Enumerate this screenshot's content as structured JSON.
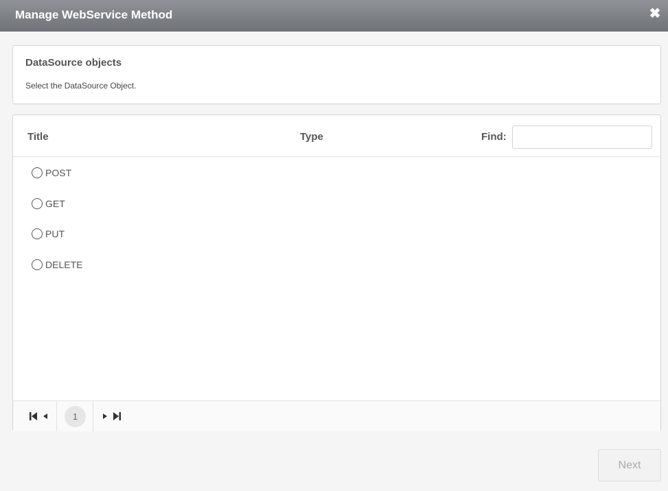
{
  "dialog": {
    "title": "Manage WebService Method",
    "close_icon": "close-icon"
  },
  "info_panel": {
    "heading": "DataSource objects",
    "description": "Select the DataSource Object."
  },
  "grid": {
    "columns": [
      "Title",
      "Type"
    ],
    "find_label": "Find:",
    "find_value": "",
    "rows": [
      {
        "title": "POST",
        "type": ""
      },
      {
        "title": "GET",
        "type": ""
      },
      {
        "title": "PUT",
        "type": ""
      },
      {
        "title": "DELETE",
        "type": ""
      }
    ]
  },
  "pager": {
    "current_page": "1",
    "icons": [
      "first-page-icon",
      "previous-page-icon",
      "next-page-icon",
      "last-page-icon"
    ]
  },
  "footer": {
    "next_label": "Next"
  }
}
